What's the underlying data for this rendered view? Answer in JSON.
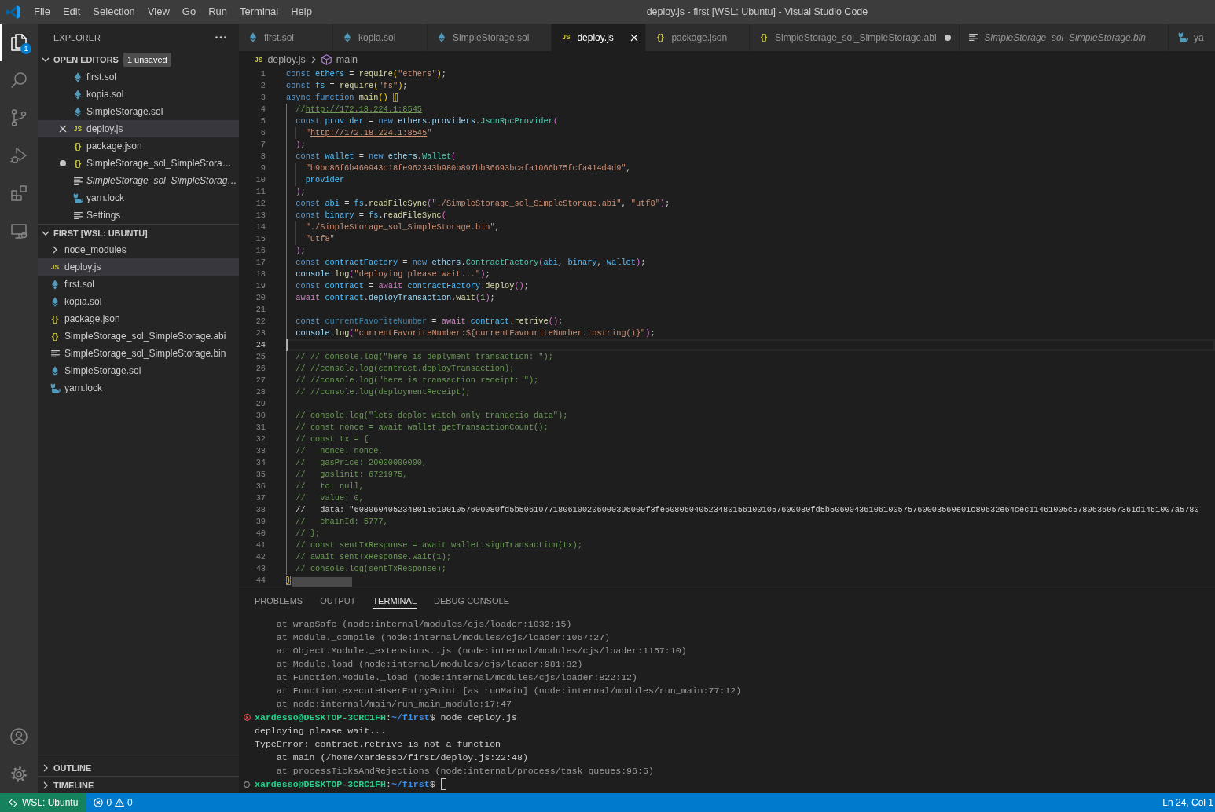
{
  "window": {
    "title": "deploy.js - first [WSL: Ubuntu] - Visual Studio Code"
  },
  "menu": [
    "File",
    "Edit",
    "Selection",
    "View",
    "Go",
    "Run",
    "Terminal",
    "Help"
  ],
  "activity_bar": {
    "top": [
      {
        "kind": "explorer",
        "selected": true,
        "badge": "1"
      },
      {
        "kind": "search",
        "selected": false
      },
      {
        "kind": "source-control",
        "selected": false
      },
      {
        "kind": "run-debug",
        "selected": false
      },
      {
        "kind": "extensions",
        "selected": false
      },
      {
        "kind": "remote",
        "selected": false
      }
    ],
    "bottom": [
      {
        "kind": "account"
      },
      {
        "kind": "manage"
      }
    ]
  },
  "explorer": {
    "title": "EXPLORER",
    "open_editors": {
      "title": "OPEN EDITORS",
      "expanded": true,
      "badge": "1 unsaved",
      "items": [
        {
          "kind": "sol",
          "name": "first.sol",
          "selected": false,
          "unsaved": false,
          "preview": false
        },
        {
          "kind": "sol",
          "name": "kopia.sol",
          "selected": false,
          "unsaved": false,
          "preview": false
        },
        {
          "kind": "sol",
          "name": "SimpleStorage.sol",
          "selected": false,
          "unsaved": false,
          "preview": false
        },
        {
          "kind": "js",
          "icon_text": "JS",
          "name": "deploy.js",
          "selected": true,
          "unsaved": false,
          "preview": false
        },
        {
          "kind": "json",
          "icon_text": "{}",
          "name": "package.json",
          "selected": false,
          "unsaved": false,
          "preview": false
        },
        {
          "kind": "json",
          "icon_text": "{}",
          "name": "SimpleStorage_sol_SimpleStora…",
          "selected": false,
          "unsaved": true,
          "preview": false
        },
        {
          "kind": "text",
          "name": "SimpleStorage_sol_SimpleStorag…",
          "selected": false,
          "unsaved": false,
          "preview": true
        },
        {
          "kind": "yarn",
          "name": "yarn.lock",
          "selected": false,
          "unsaved": false,
          "preview": false
        },
        {
          "kind": "text",
          "name": "Settings",
          "selected": false,
          "unsaved": false,
          "preview": false
        }
      ]
    },
    "folder": {
      "title": "FIRST [WSL: UBUNTU]",
      "expanded": true,
      "items": [
        {
          "kind": "folder",
          "name": "node_modules",
          "expanded": false,
          "selected": false
        },
        {
          "kind": "js",
          "icon_text": "JS",
          "name": "deploy.js",
          "selected": true
        },
        {
          "kind": "sol",
          "name": "first.sol",
          "selected": false
        },
        {
          "kind": "sol",
          "name": "kopia.sol",
          "selected": false
        },
        {
          "kind": "json",
          "icon_text": "{}",
          "name": "package.json",
          "selected": false
        },
        {
          "kind": "json",
          "icon_text": "{}",
          "name": "SimpleStorage_sol_SimpleStorage.abi",
          "selected": false
        },
        {
          "kind": "text",
          "name": "SimpleStorage_sol_SimpleStorage.bin",
          "selected": false
        },
        {
          "kind": "sol",
          "name": "SimpleStorage.sol",
          "selected": false
        },
        {
          "kind": "yarn",
          "name": "yarn.lock",
          "selected": false
        }
      ]
    },
    "sections": [
      {
        "title": "OUTLINE",
        "expanded": false
      },
      {
        "title": "TIMELINE",
        "expanded": false
      }
    ]
  },
  "tabs": [
    {
      "kind": "sol",
      "label": "first.sol",
      "selected": false,
      "unsaved": false,
      "preview": false
    },
    {
      "kind": "sol",
      "label": "kopia.sol",
      "selected": false,
      "unsaved": false,
      "preview": false
    },
    {
      "kind": "sol",
      "label": "SimpleStorage.sol",
      "selected": false,
      "unsaved": false,
      "preview": false
    },
    {
      "kind": "js",
      "icon_text": "JS",
      "label": "deploy.js",
      "selected": true,
      "unsaved": false,
      "preview": false
    },
    {
      "kind": "json",
      "icon_text": "{}",
      "label": "package.json",
      "selected": false,
      "unsaved": false,
      "preview": false
    },
    {
      "kind": "json",
      "icon_text": "{}",
      "label": "SimpleStorage_sol_SimpleStorage.abi",
      "selected": false,
      "unsaved": true,
      "preview": false
    },
    {
      "kind": "text",
      "label": "SimpleStorage_sol_SimpleStorage.bin",
      "selected": false,
      "unsaved": false,
      "preview": true
    },
    {
      "kind": "yarn",
      "label": "ya",
      "selected": false,
      "unsaved": false,
      "preview": false
    }
  ],
  "breadcrumb": [
    {
      "kind": "js",
      "icon_text": "JS",
      "label": "deploy.js"
    },
    {
      "kind": "symbol",
      "label": "main"
    }
  ],
  "editor": {
    "lines": [
      {
        "number": "1",
        "current": false,
        "tokens": [
          {
            "kind": "keyword",
            "text": "const "
          },
          {
            "kind": "constant",
            "text": "ethers"
          },
          {
            "kind": "punctuation",
            "text": " = "
          },
          {
            "kind": "function",
            "text": "require"
          },
          {
            "kind": "bracket1",
            "text": "("
          },
          {
            "kind": "string",
            "text": "\"ethers\""
          },
          {
            "kind": "bracket1",
            "text": ")"
          },
          {
            "kind": "punctuation",
            "text": ";"
          }
        ]
      },
      {
        "number": "2",
        "current": false,
        "tokens": [
          {
            "kind": "keyword",
            "text": "const "
          },
          {
            "kind": "constant",
            "text": "fs"
          },
          {
            "kind": "punctuation",
            "text": " = "
          },
          {
            "kind": "function",
            "text": "require"
          },
          {
            "kind": "bracket1",
            "text": "("
          },
          {
            "kind": "string",
            "text": "\"fs\""
          },
          {
            "kind": "bracket1",
            "text": ")"
          },
          {
            "kind": "punctuation",
            "text": ";"
          }
        ]
      },
      {
        "number": "3",
        "current": false,
        "tokens": [
          {
            "kind": "keyword",
            "text": "async function "
          },
          {
            "kind": "function",
            "text": "main"
          },
          {
            "kind": "bracket1",
            "text": "() "
          },
          {
            "kind": "match",
            "text": "{"
          }
        ]
      },
      {
        "number": "4",
        "current": false,
        "tokens": [
          {
            "kind": "comment",
            "text": "  //"
          },
          {
            "kind": "commentlink",
            "text": "http://172.18.224.1:8545"
          }
        ]
      },
      {
        "number": "5",
        "current": false,
        "tokens": [
          {
            "kind": "keyword",
            "text": "  const "
          },
          {
            "kind": "constant",
            "text": "provider"
          },
          {
            "kind": "punctuation",
            "text": " = "
          },
          {
            "kind": "keyword",
            "text": "new "
          },
          {
            "kind": "variable",
            "text": "ethers"
          },
          {
            "kind": "punctuation",
            "text": "."
          },
          {
            "kind": "variable",
            "text": "providers"
          },
          {
            "kind": "punctuation",
            "text": "."
          },
          {
            "kind": "class",
            "text": "JsonRpcProvider"
          },
          {
            "kind": "bracket2",
            "text": "("
          }
        ]
      },
      {
        "number": "6",
        "current": false,
        "tokens": [
          {
            "kind": "string",
            "text": "    \""
          },
          {
            "kind": "link",
            "text": "http://172.18.224.1:8545"
          },
          {
            "kind": "string",
            "text": "\""
          }
        ]
      },
      {
        "number": "7",
        "current": false,
        "tokens": [
          {
            "kind": "bracket2",
            "text": "  )"
          },
          {
            "kind": "punctuation",
            "text": ";"
          }
        ]
      },
      {
        "number": "8",
        "current": false,
        "tokens": [
          {
            "kind": "keyword",
            "text": "  const "
          },
          {
            "kind": "constant",
            "text": "wallet"
          },
          {
            "kind": "punctuation",
            "text": " = "
          },
          {
            "kind": "keyword",
            "text": "new "
          },
          {
            "kind": "variable",
            "text": "ethers"
          },
          {
            "kind": "punctuation",
            "text": "."
          },
          {
            "kind": "class",
            "text": "Wallet"
          },
          {
            "kind": "bracket2",
            "text": "("
          }
        ]
      },
      {
        "number": "9",
        "current": false,
        "tokens": [
          {
            "kind": "string",
            "text": "    \"b9bc86f6b460943c18fe962343b980b897bb36693bcafa1066b75fcfa414d4d9\""
          },
          {
            "kind": "punctuation",
            "text": ","
          }
        ]
      },
      {
        "number": "10",
        "current": false,
        "tokens": [
          {
            "kind": "constant",
            "text": "    provider"
          }
        ]
      },
      {
        "number": "11",
        "current": false,
        "tokens": [
          {
            "kind": "bracket2",
            "text": "  )"
          },
          {
            "kind": "punctuation",
            "text": ";"
          }
        ]
      },
      {
        "number": "12",
        "current": false,
        "tokens": [
          {
            "kind": "keyword",
            "text": "  const "
          },
          {
            "kind": "constant",
            "text": "abi"
          },
          {
            "kind": "punctuation",
            "text": " = "
          },
          {
            "kind": "constant",
            "text": "fs"
          },
          {
            "kind": "punctuation",
            "text": "."
          },
          {
            "kind": "function",
            "text": "readFileSync"
          },
          {
            "kind": "bracket2",
            "text": "("
          },
          {
            "kind": "string",
            "text": "\"./SimpleStorage_sol_SimpleStorage.abi\""
          },
          {
            "kind": "punctuation",
            "text": ", "
          },
          {
            "kind": "string",
            "text": "\"utf8\""
          },
          {
            "kind": "bracket2",
            "text": ")"
          },
          {
            "kind": "punctuation",
            "text": ";"
          }
        ]
      },
      {
        "number": "13",
        "current": false,
        "tokens": [
          {
            "kind": "keyword",
            "text": "  const "
          },
          {
            "kind": "constant",
            "text": "binary"
          },
          {
            "kind": "punctuation",
            "text": " = "
          },
          {
            "kind": "constant",
            "text": "fs"
          },
          {
            "kind": "punctuation",
            "text": "."
          },
          {
            "kind": "function",
            "text": "readFileSync"
          },
          {
            "kind": "bracket2",
            "text": "("
          }
        ]
      },
      {
        "number": "14",
        "current": false,
        "tokens": [
          {
            "kind": "string",
            "text": "    \"./SimpleStorage_sol_SimpleStorage.bin\""
          },
          {
            "kind": "punctuation",
            "text": ","
          }
        ]
      },
      {
        "number": "15",
        "current": false,
        "tokens": [
          {
            "kind": "string",
            "text": "    \"utf8\""
          }
        ]
      },
      {
        "number": "16",
        "current": false,
        "tokens": [
          {
            "kind": "bracket2",
            "text": "  )"
          },
          {
            "kind": "punctuation",
            "text": ";"
          }
        ]
      },
      {
        "number": "17",
        "current": false,
        "tokens": [
          {
            "kind": "keyword",
            "text": "  const "
          },
          {
            "kind": "constant",
            "text": "contractFactory"
          },
          {
            "kind": "punctuation",
            "text": " = "
          },
          {
            "kind": "keyword",
            "text": "new "
          },
          {
            "kind": "variable",
            "text": "ethers"
          },
          {
            "kind": "punctuation",
            "text": "."
          },
          {
            "kind": "class",
            "text": "ContractFactory"
          },
          {
            "kind": "bracket2",
            "text": "("
          },
          {
            "kind": "constant",
            "text": "abi"
          },
          {
            "kind": "punctuation",
            "text": ", "
          },
          {
            "kind": "constant",
            "text": "binary"
          },
          {
            "kind": "punctuation",
            "text": ", "
          },
          {
            "kind": "constant",
            "text": "wallet"
          },
          {
            "kind": "bracket2",
            "text": ")"
          },
          {
            "kind": "punctuation",
            "text": ";"
          }
        ]
      },
      {
        "number": "18",
        "current": false,
        "tokens": [
          {
            "kind": "variable",
            "text": "  console"
          },
          {
            "kind": "punctuation",
            "text": "."
          },
          {
            "kind": "function",
            "text": "log"
          },
          {
            "kind": "bracket2",
            "text": "("
          },
          {
            "kind": "string",
            "text": "\"deploying please wait...\""
          },
          {
            "kind": "bracket2",
            "text": ")"
          },
          {
            "kind": "punctuation",
            "text": ";"
          }
        ]
      },
      {
        "number": "19",
        "current": false,
        "tokens": [
          {
            "kind": "keyword",
            "text": "  const "
          },
          {
            "kind": "constant",
            "text": "contract"
          },
          {
            "kind": "punctuation",
            "text": " = "
          },
          {
            "kind": "control",
            "text": "await "
          },
          {
            "kind": "constant",
            "text": "contractFactory"
          },
          {
            "kind": "punctuation",
            "text": "."
          },
          {
            "kind": "function",
            "text": "deploy"
          },
          {
            "kind": "bracket2",
            "text": "()"
          },
          {
            "kind": "punctuation",
            "text": ";"
          }
        ]
      },
      {
        "number": "20",
        "current": false,
        "tokens": [
          {
            "kind": "control",
            "text": "  await "
          },
          {
            "kind": "constant",
            "text": "contract"
          },
          {
            "kind": "punctuation",
            "text": "."
          },
          {
            "kind": "variable",
            "text": "deployTransaction"
          },
          {
            "kind": "punctuation",
            "text": "."
          },
          {
            "kind": "function",
            "text": "wait"
          },
          {
            "kind": "bracket2",
            "text": "("
          },
          {
            "kind": "number",
            "text": "1"
          },
          {
            "kind": "bracket2",
            "text": ")"
          },
          {
            "kind": "punctuation",
            "text": ";"
          }
        ]
      },
      {
        "number": "21",
        "current": false
      },
      {
        "number": "22",
        "current": false,
        "tokens": [
          {
            "kind": "keyword",
            "text": "  const "
          },
          {
            "kind": "unused",
            "text": "currentFavoriteNumber"
          },
          {
            "kind": "punctuation",
            "text": " = "
          },
          {
            "kind": "control",
            "text": "await "
          },
          {
            "kind": "constant",
            "text": "contract"
          },
          {
            "kind": "punctuation",
            "text": "."
          },
          {
            "kind": "function",
            "text": "retrive"
          },
          {
            "kind": "bracket2",
            "text": "()"
          },
          {
            "kind": "punctuation",
            "text": ";"
          }
        ]
      },
      {
        "number": "23",
        "current": false,
        "tokens": [
          {
            "kind": "variable",
            "text": "  console"
          },
          {
            "kind": "punctuation",
            "text": "."
          },
          {
            "kind": "function",
            "text": "log"
          },
          {
            "kind": "bracket2",
            "text": "("
          },
          {
            "kind": "string",
            "text": "\"currentFavoriteNumber:${currentFavouriteNumber.tostring()}\""
          },
          {
            "kind": "bracket2",
            "text": ")"
          },
          {
            "kind": "punctuation",
            "text": ";"
          }
        ]
      },
      {
        "number": "24",
        "current": true
      },
      {
        "number": "25",
        "current": false,
        "tokens": [
          {
            "kind": "comment",
            "text": "  // // console.log(\"here is deplyment transaction: \");"
          }
        ]
      },
      {
        "number": "26",
        "current": false,
        "tokens": [
          {
            "kind": "comment",
            "text": "  // //console.log(contract.deployTransaction);"
          }
        ]
      },
      {
        "number": "27",
        "current": false,
        "tokens": [
          {
            "kind": "comment",
            "text": "  // //console.log(\"here is transaction receipt: \");"
          }
        ]
      },
      {
        "number": "28",
        "current": false,
        "tokens": [
          {
            "kind": "comment",
            "text": "  // //console.log(deploymentReceipt);"
          }
        ]
      },
      {
        "number": "29",
        "current": false
      },
      {
        "number": "30",
        "current": false,
        "tokens": [
          {
            "kind": "comment",
            "text": "  // console.log(\"lets deplot witch only tranactio data\");"
          }
        ]
      },
      {
        "number": "31",
        "current": false,
        "tokens": [
          {
            "kind": "comment",
            "text": "  // const nonce = await wallet.getTransactionCount();"
          }
        ]
      },
      {
        "number": "32",
        "current": false,
        "tokens": [
          {
            "kind": "comment",
            "text": "  // const tx = {"
          }
        ]
      },
      {
        "number": "33",
        "current": false,
        "tokens": [
          {
            "kind": "comment",
            "text": "  //   nonce: nonce,"
          }
        ]
      },
      {
        "number": "34",
        "current": false,
        "tokens": [
          {
            "kind": "comment",
            "text": "  //   gasPrice: 20000000000,"
          }
        ]
      },
      {
        "number": "35",
        "current": false,
        "tokens": [
          {
            "kind": "comment",
            "text": "  //   gaslimit: 6721975,"
          }
        ]
      },
      {
        "number": "36",
        "current": false,
        "tokens": [
          {
            "kind": "comment",
            "text": "  //   to: null,"
          }
        ]
      },
      {
        "number": "37",
        "current": false,
        "tokens": [
          {
            "kind": "comment",
            "text": "  //   value: 0,"
          }
        ]
      },
      {
        "number": "38",
        "current": false,
        "tokens": [
          {
            "kind": "plain",
            "text": "  //   data: \"608060405234801561001057600080fd5b50610771806100206000396000f3fe608060405234801561001057600080fd5b50600436106100575760003560e01c80632e64cec11461005c5780636057361d1461007a5780"
          }
        ]
      },
      {
        "number": "39",
        "current": false,
        "tokens": [
          {
            "kind": "comment",
            "text": "  //   chainId: 5777,"
          }
        ]
      },
      {
        "number": "40",
        "current": false,
        "tokens": [
          {
            "kind": "comment",
            "text": "  // };"
          }
        ]
      },
      {
        "number": "41",
        "current": false,
        "tokens": [
          {
            "kind": "comment",
            "text": "  // const sentTxResponse = await wallet.signTransaction(tx);"
          }
        ]
      },
      {
        "number": "42",
        "current": false,
        "tokens": [
          {
            "kind": "comment",
            "text": "  // await sentTxResponse.wait(1);"
          }
        ]
      },
      {
        "number": "43",
        "current": false,
        "tokens": [
          {
            "kind": "comment",
            "text": "  // console.log(sentTxResponse);"
          }
        ]
      },
      {
        "number": "44",
        "current": false,
        "tokens": [
          {
            "kind": "match",
            "text": "}"
          }
        ]
      }
    ]
  },
  "panel": {
    "tabs": [
      {
        "label": "PROBLEMS",
        "selected": false
      },
      {
        "label": "OUTPUT",
        "selected": false
      },
      {
        "label": "TERMINAL",
        "selected": true
      },
      {
        "label": "DEBUG CONSOLE",
        "selected": false
      }
    ],
    "terminal": {
      "cursor": true,
      "lines": [
        {
          "kind": "output",
          "segments": [
            {
              "kind": "dim",
              "text": "    at wrapSafe (node:internal/modules/cjs/loader:1032:15)"
            }
          ]
        },
        {
          "kind": "output",
          "segments": [
            {
              "kind": "dim",
              "text": "    at Module._compile (node:internal/modules/cjs/loader:1067:27)"
            }
          ]
        },
        {
          "kind": "output",
          "segments": [
            {
              "kind": "dim",
              "text": "    at Object.Module._extensions..js (node:internal/modules/cjs/loader:1157:10)"
            }
          ]
        },
        {
          "kind": "output",
          "segments": [
            {
              "kind": "dim",
              "text": "    at Module.load (node:internal/modules/cjs/loader:981:32)"
            }
          ]
        },
        {
          "kind": "output",
          "segments": [
            {
              "kind": "dim",
              "text": "    at Function.Module._load (node:internal/modules/cjs/loader:822:12)"
            }
          ]
        },
        {
          "kind": "output",
          "segments": [
            {
              "kind": "dim",
              "text": "    at Function.executeUserEntryPoint [as runMain] (node:internal/modules/run_main:77:12)"
            }
          ]
        },
        {
          "kind": "output",
          "segments": [
            {
              "kind": "dim",
              "text": "    at node:internal/main/run_main_module:17:47"
            }
          ]
        },
        {
          "kind": "failed",
          "segments": [
            {
              "kind": "user",
              "text": "xardesso@DESKTOP-3CRC1FH"
            },
            {
              "kind": "plain",
              "text": ":"
            },
            {
              "kind": "path",
              "text": "~/first"
            },
            {
              "kind": "plain",
              "text": "$ node deploy.js"
            }
          ]
        },
        {
          "kind": "output",
          "segments": [
            {
              "kind": "plain",
              "text": "deploying please wait..."
            }
          ]
        },
        {
          "kind": "output",
          "segments": [
            {
              "kind": "plain",
              "text": "TypeError: contract.retrive is not a function"
            }
          ]
        },
        {
          "kind": "output",
          "segments": [
            {
              "kind": "plain",
              "text": "    at main (/home/xardesso/first/deploy.js:22:48)"
            }
          ]
        },
        {
          "kind": "output",
          "segments": [
            {
              "kind": "dim",
              "text": "    at processTicksAndRejections (node:internal/process/task_queues:96:5)"
            }
          ]
        },
        {
          "kind": "prompt",
          "segments": [
            {
              "kind": "user",
              "text": "xardesso@DESKTOP-3CRC1FH"
            },
            {
              "kind": "plain",
              "text": ":"
            },
            {
              "kind": "path",
              "text": "~/first"
            },
            {
              "kind": "plain",
              "text": "$"
            }
          ]
        }
      ]
    }
  },
  "status_bar": {
    "remote": "WSL: Ubuntu",
    "errors": "0",
    "warnings": "0",
    "position": "Ln 24, Col 1"
  }
}
